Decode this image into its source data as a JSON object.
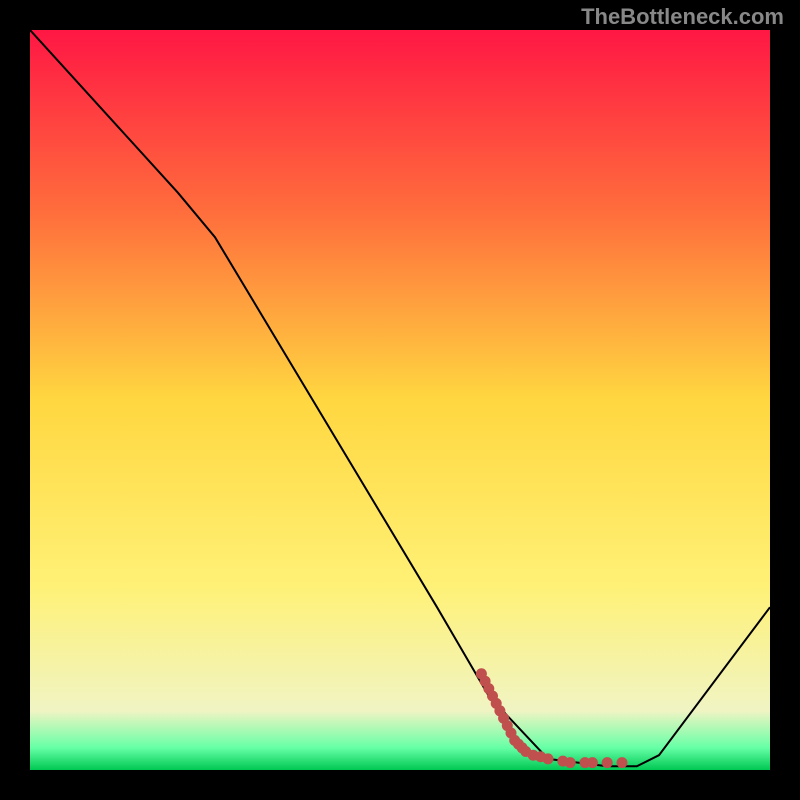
{
  "watermark": "TheBottleneck.com",
  "chart_data": {
    "type": "line",
    "title": "",
    "xlabel": "",
    "ylabel": "",
    "xlim": [
      0,
      100
    ],
    "ylim": [
      0,
      100
    ],
    "gradient_stops": [
      {
        "offset": 0,
        "color": "#ff1744"
      },
      {
        "offset": 25,
        "color": "#ff6f3c"
      },
      {
        "offset": 50,
        "color": "#ffd740"
      },
      {
        "offset": 75,
        "color": "#fff176"
      },
      {
        "offset": 92,
        "color": "#f0f4c3"
      },
      {
        "offset": 97,
        "color": "#66ffa6"
      },
      {
        "offset": 100,
        "color": "#00c853"
      }
    ],
    "series": [
      {
        "name": "bottleneck-curve",
        "color": "#000000",
        "points": [
          {
            "x": 0,
            "y": 100
          },
          {
            "x": 20,
            "y": 78
          },
          {
            "x": 25,
            "y": 72
          },
          {
            "x": 55,
            "y": 22
          },
          {
            "x": 62,
            "y": 10
          },
          {
            "x": 70,
            "y": 1.5
          },
          {
            "x": 78,
            "y": 0.5
          },
          {
            "x": 82,
            "y": 0.5
          },
          {
            "x": 85,
            "y": 2
          },
          {
            "x": 100,
            "y": 22
          }
        ]
      }
    ],
    "marker_series": {
      "name": "highlight-dots",
      "color": "#c0504d",
      "points": [
        {
          "x": 61,
          "y": 13
        },
        {
          "x": 61.5,
          "y": 12
        },
        {
          "x": 62,
          "y": 11
        },
        {
          "x": 62.5,
          "y": 10
        },
        {
          "x": 63,
          "y": 9
        },
        {
          "x": 63.5,
          "y": 8
        },
        {
          "x": 64,
          "y": 7
        },
        {
          "x": 64.5,
          "y": 6
        },
        {
          "x": 65,
          "y": 5
        },
        {
          "x": 65.5,
          "y": 4
        },
        {
          "x": 66,
          "y": 3.5
        },
        {
          "x": 66.5,
          "y": 3
        },
        {
          "x": 67,
          "y": 2.5
        },
        {
          "x": 68,
          "y": 2
        },
        {
          "x": 69,
          "y": 1.8
        },
        {
          "x": 70,
          "y": 1.5
        },
        {
          "x": 72,
          "y": 1.2
        },
        {
          "x": 73,
          "y": 1
        },
        {
          "x": 75,
          "y": 1
        },
        {
          "x": 76,
          "y": 1
        },
        {
          "x": 78,
          "y": 1
        },
        {
          "x": 80,
          "y": 1
        }
      ]
    }
  }
}
